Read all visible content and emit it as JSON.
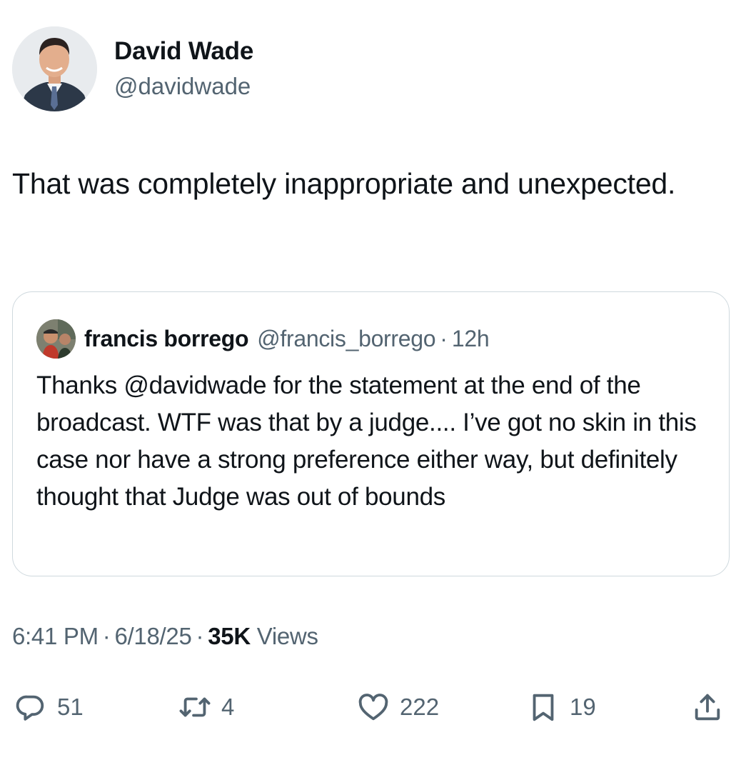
{
  "author": {
    "display_name": "David Wade",
    "handle": "@davidwade"
  },
  "tweet": {
    "text": "That was completely inappropriate and unexpected."
  },
  "quoted_tweet": {
    "display_name": "francis borrego",
    "handle": "@francis_borrego",
    "separator": "·",
    "time_ago": "12h",
    "text": "Thanks @davidwade for the statement at the end of the broadcast. WTF was that by a judge.... I’ve got no skin in this case nor have a strong preference either way, but definitely thought that Judge was out of bounds"
  },
  "meta": {
    "time": "6:41 PM",
    "separator": "·",
    "date": "6/18/25",
    "views_count": "35K",
    "views_label": "Views"
  },
  "actions": {
    "replies": "51",
    "retweets": "4",
    "likes": "222",
    "bookmarks": "19"
  },
  "icons": {
    "reply": "reply-icon",
    "retweet": "retweet-icon",
    "like": "heart-icon",
    "bookmark": "bookmark-icon",
    "share": "share-icon"
  },
  "colors": {
    "text_primary": "#0f1419",
    "text_secondary": "#536471",
    "border": "#cfd9de"
  }
}
